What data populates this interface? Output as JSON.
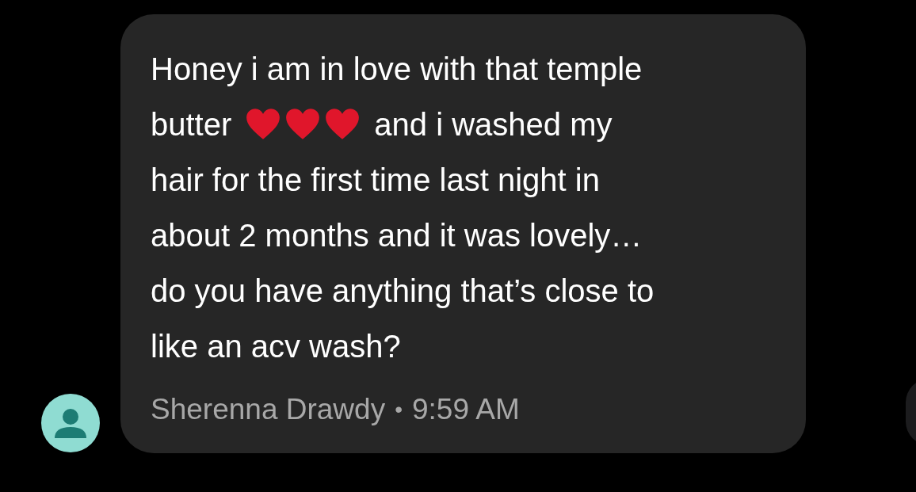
{
  "message": {
    "lines": [
      {
        "parts": [
          {
            "kind": "text",
            "text": "Honey i am in love with that temple"
          }
        ]
      },
      {
        "parts": [
          {
            "kind": "text",
            "text": "butter"
          },
          {
            "kind": "heart"
          },
          {
            "kind": "heart"
          },
          {
            "kind": "heart"
          },
          {
            "kind": "text",
            "text": "and i washed my"
          }
        ]
      },
      {
        "parts": [
          {
            "kind": "text",
            "text": "hair for the first time last night in"
          }
        ]
      },
      {
        "parts": [
          {
            "kind": "text",
            "text": "about 2 months and it was lovely…"
          }
        ]
      },
      {
        "parts": [
          {
            "kind": "text",
            "text": "do you have anything that’s close to"
          }
        ]
      },
      {
        "parts": [
          {
            "kind": "text",
            "text": "like an acv wash?"
          }
        ]
      }
    ],
    "sender": "Sherenna Drawdy",
    "separator": "•",
    "time": "9:59 AM"
  }
}
